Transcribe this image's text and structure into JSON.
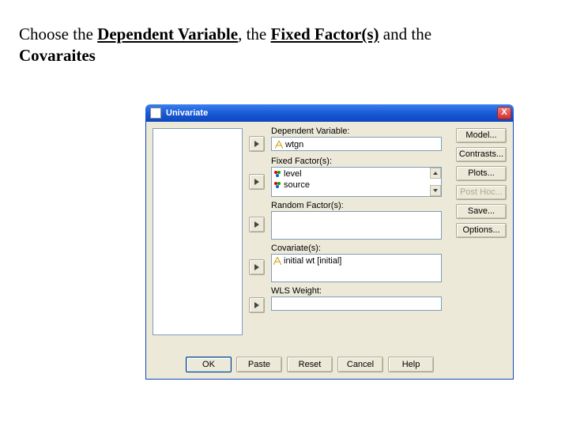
{
  "instruction": {
    "pre": "Choose the ",
    "dv": "Dependent Variable",
    "mid1": ", the ",
    "ff": "Fixed Factor(s)",
    "mid2": " and the ",
    "cov": "Covaraites"
  },
  "dialog": {
    "title": "Univariate",
    "close": "X",
    "labels": {
      "dependent": "Dependent Variable:",
      "fixed": "Fixed Factor(s):",
      "random": "Random Factor(s):",
      "covariate": "Covariate(s):",
      "wls": "WLS Weight:"
    },
    "dependent_value": "wtgn",
    "fixed_factors": [
      "level",
      "source"
    ],
    "covariates": [
      "initial wt [initial]"
    ],
    "right_buttons": {
      "model": "Model...",
      "contrasts": "Contrasts...",
      "plots": "Plots...",
      "posthoc": "Post Hoc...",
      "save": "Save...",
      "options": "Options..."
    },
    "bottom_buttons": {
      "ok": "OK",
      "paste": "Paste",
      "reset": "Reset",
      "cancel": "Cancel",
      "help": "Help"
    }
  }
}
